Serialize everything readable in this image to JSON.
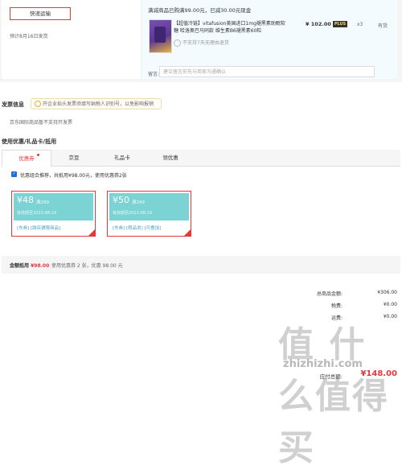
{
  "shipping": {
    "method_label": "快递运输",
    "date_text": "预计8月16日发货"
  },
  "order": {
    "promo_text": "满减商品已购满99.00元，已减30.00元现金",
    "product_name": "【超值冷链】vitafusion美国进口1mg褪黑素助眠软糖 哈洛奥巴马同款 维生素B6褪黑素60粒",
    "price": "¥ 102.00",
    "plus_badge": "PLUS",
    "qty": "x3",
    "stock": "有货",
    "no_return": "不支持7天无理由退货",
    "remark_label": "留言:",
    "remark_placeholder": "建议留言前先与商家沟通确认"
  },
  "invoice": {
    "title": "发票信息",
    "tip": "开企业抬头发票须填写纳税人识别号，以免影响报销",
    "note": "京东国际商品暂不支持开发票"
  },
  "coupons": {
    "section_title": "使用优惠/礼品卡/抵用",
    "tabs": [
      "优惠券",
      "京豆",
      "礼品卡",
      "领优惠"
    ],
    "auto_text": "优惠组合推荐，共抵用¥98.00元，使用优惠券2张",
    "items": [
      {
        "amount": "¥48",
        "condition": "满299",
        "date": "有效期至2023-08-19",
        "tags": "[东券] [跨店铺限商品]"
      },
      {
        "amount": "¥50",
        "condition": "满299",
        "date": "有效期至2023-08-19",
        "tags": "[东券] [限品类] [可叠加]"
      }
    ],
    "amount_used_label": "金额抵用",
    "amount_used_value": "¥98.00",
    "used_info": "使用优惠券 2 张，优惠 98.00 元"
  },
  "totals": {
    "rows": [
      {
        "label": "总商品金额:",
        "value": "¥306.00"
      },
      {
        "label": "税费:",
        "value": "¥0.00"
      },
      {
        "label": "运费:",
        "value": "¥0.00"
      }
    ],
    "payable_label": "应付总额:",
    "payable_value": "¥148.00"
  },
  "watermark": {
    "text": "值 什么值得买",
    "url": "zhizhizhi.com"
  }
}
